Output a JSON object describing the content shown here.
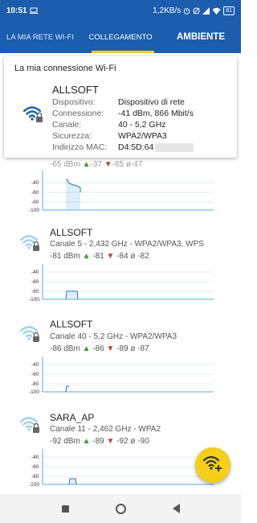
{
  "status_bar": {
    "time": "10:51",
    "speed": "1,2KB/s",
    "battery": "81"
  },
  "tabs": [
    {
      "label": "LA MIA RETE WI-FI"
    },
    {
      "label": "COLLEGAMENTO"
    },
    {
      "label": "AMBIENTE"
    }
  ],
  "connection": {
    "title": "La mia connessione Wi-Fi",
    "ssid": "ALLSOFT",
    "fields": [
      {
        "key": "Dispositivo:",
        "value": "Dispositivo di rete"
      },
      {
        "key": "Connessione:",
        "value": "-41 dBm, 866 Mbit/s"
      },
      {
        "key": "Canale:",
        "value": "40 - 5,2 GHz"
      },
      {
        "key": "Sicurezza:",
        "value": "WPA2/WPA3"
      },
      {
        "key": "Indirizzo MAC:",
        "value": "D4:5D:64"
      }
    ]
  },
  "partial_network": {
    "current": "-65 dBm",
    "max": "-37",
    "min": "-65",
    "avg": "-47"
  },
  "networks": [
    {
      "ssid": "ALLSOFT",
      "info": "Canale 5 - 2,432 GHz - WPA2/WPA3, WPS",
      "current": "-81 dBm",
      "max": "-81",
      "min": "-84",
      "avg": "-82"
    },
    {
      "ssid": "ALLSOFT",
      "info": "Canale 40 - 5,2 GHz - WPA2/WPA3",
      "current": "-86 dBm",
      "max": "-86",
      "min": "-89",
      "avg": "-87"
    },
    {
      "ssid": "SARA_AP",
      "info": "Canale 11 - 2,462 GHz - WPA2",
      "current": "-92 dBm",
      "max": "-89",
      "min": "-92",
      "avg": "-90"
    }
  ],
  "graph_axis_labels": [
    "-40",
    "-60",
    "-80",
    "-100"
  ],
  "icons": {
    "wifi_locked": "wifi-lock-icon",
    "fab": "wifi-add-icon"
  },
  "colors": {
    "primary": "#1c5dad",
    "accent": "#f4cf1b",
    "signal_strong": "#1c5dad",
    "signal_weak": "#9fd0ec"
  }
}
